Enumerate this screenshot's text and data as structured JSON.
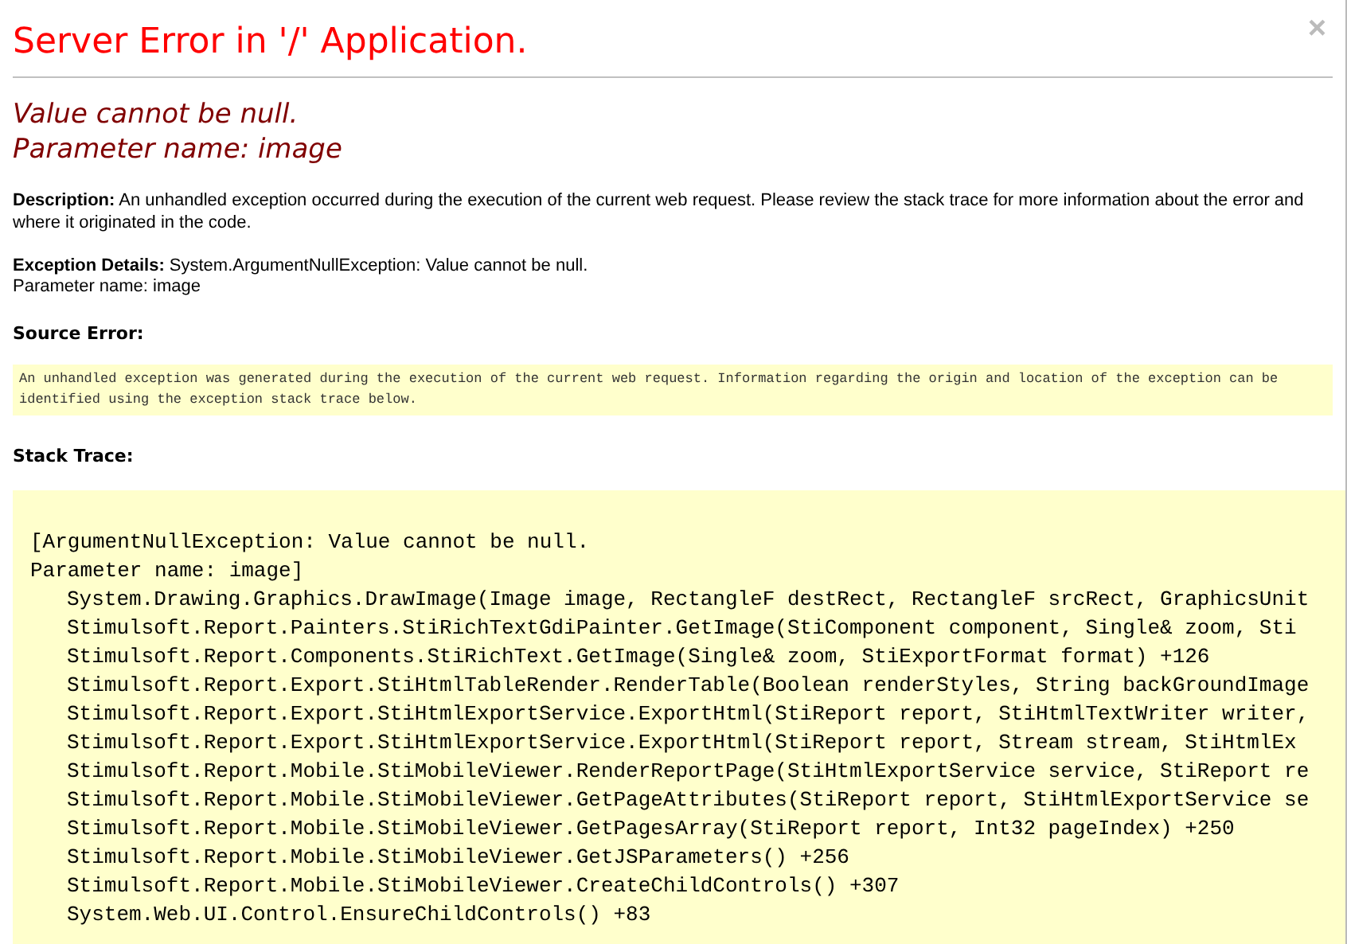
{
  "title": "Server Error in '/' Application.",
  "close": "×",
  "error_heading": [
    "Value cannot be null.",
    "Parameter name: image"
  ],
  "description": "**Description:** An unhandled exception occurred during the execution of the current web request. Please review the stack trace for more information about the error and where it originated in the code.",
  "exception_details": [
    "**Exception Details:** System.ArgumentNullException: Value cannot be null.",
    "Parameter name: image"
  ],
  "source_error": {
    "label": "Source Error:",
    "text": "An unhandled exception was generated during the execution of the current web request. Information regarding the origin and location of the exception can be identified using the exception stack trace below."
  },
  "stack_trace": {
    "label": "Stack Trace:",
    "exception": [
      "[ArgumentNullException: Value cannot be null.",
      "Parameter name: image]"
    ],
    "frames": [
      "System.Drawing.Graphics.DrawImage(Image image, RectangleF destRect, RectangleF srcRect, GraphicsUnit",
      "Stimulsoft.Report.Painters.StiRichTextGdiPainter.GetImage(StiComponent component, Single& zoom, Sti",
      "Stimulsoft.Report.Components.StiRichText.GetImage(Single& zoom, StiExportFormat format) +126",
      "Stimulsoft.Report.Export.StiHtmlTableRender.RenderTable(Boolean renderStyles, String backGroundImage",
      "Stimulsoft.Report.Export.StiHtmlExportService.ExportHtml(StiReport report, StiHtmlTextWriter writer,",
      "Stimulsoft.Report.Export.StiHtmlExportService.ExportHtml(StiReport report, Stream stream, StiHtmlEx",
      "Stimulsoft.Report.Mobile.StiMobileViewer.RenderReportPage(StiHtmlExportService service, StiReport re",
      "Stimulsoft.Report.Mobile.StiMobileViewer.GetPageAttributes(StiReport report, StiHtmlExportService se",
      "Stimulsoft.Report.Mobile.StiMobileViewer.GetPagesArray(StiReport report, Int32 pageIndex) +250",
      "Stimulsoft.Report.Mobile.StiMobileViewer.GetJSParameters() +256",
      "Stimulsoft.Report.Mobile.StiMobileViewer.CreateChildControls() +307",
      "System.Web.UI.Control.EnsureChildControls() +83"
    ]
  }
}
